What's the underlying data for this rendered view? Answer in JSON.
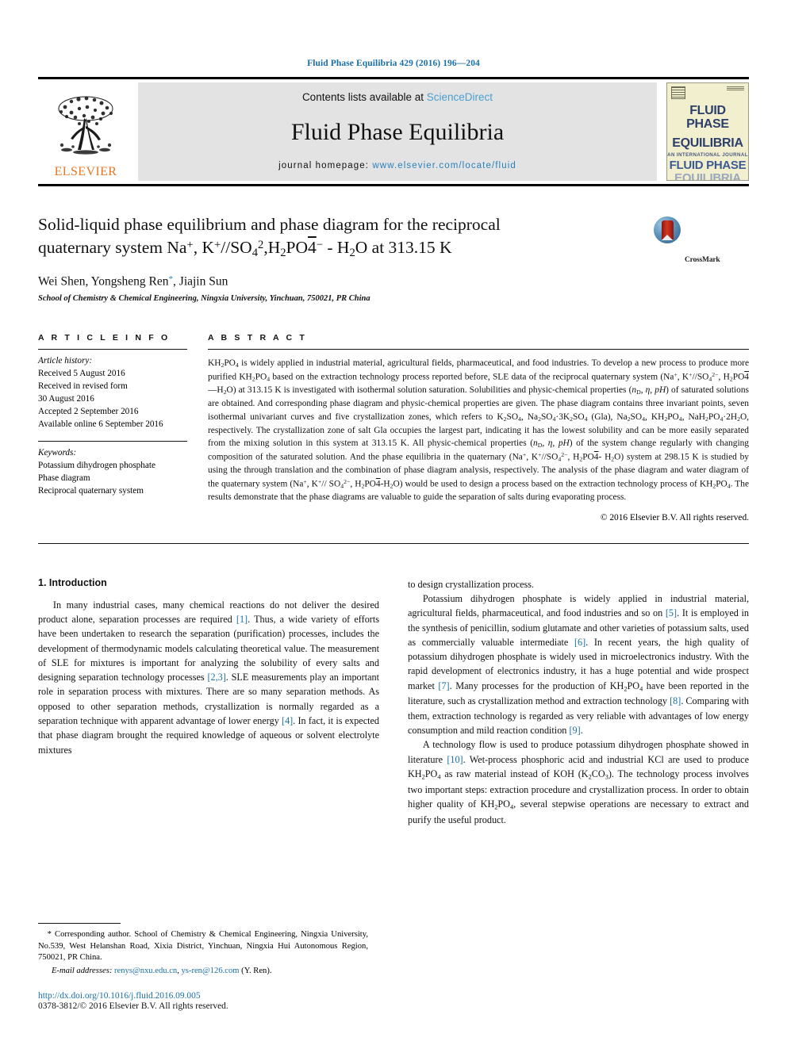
{
  "running_head": "Fluid Phase Equilibria 429 (2016) 196—204",
  "masthead": {
    "contents_prefix": "Contents lists available at ",
    "contents_link": "ScienceDirect",
    "journal_title": "Fluid Phase Equilibria",
    "homepage_prefix": "journal homepage: ",
    "homepage_url": "www.elsevier.com/locate/fluid",
    "publisher": "ELSEVIER",
    "cover": {
      "line1": "FLUID PHASE",
      "line2": "EQUILIBRIA",
      "subtitle": "AN INTERNATIONAL JOURNAL",
      "line3": "FLUID PHASE",
      "line4": "EQUILIBRIA"
    }
  },
  "article": {
    "title_line1": "Solid-liquid phase equilibrium and phase diagram for the reciprocal",
    "title_line2_pre": "quaternary system Na",
    "title_full_plain": "Solid-liquid phase equilibrium and phase diagram for the reciprocal quaternary system Na+, K+//SO42-,H2PO4- - H2O at 313.15 K",
    "crossmark_label": "CrossMark",
    "authors_plain": "Wei Shen, Yongsheng Ren*, Jiajin Sun",
    "author1": "Wei Shen, Yongsheng Ren",
    "author2": ", Jiajin Sun",
    "affiliation": "School of Chemistry & Chemical Engineering, Ningxia University, Yinchuan, 750021, PR China"
  },
  "info": {
    "heading": "A R T I C L E   I N F O",
    "history_label": "Article history:",
    "history": [
      "Received 5 August 2016",
      "Received in revised form",
      "30 August 2016",
      "Accepted 2 September 2016",
      "Available online 6 September 2016"
    ],
    "keywords_label": "Keywords:",
    "keywords": [
      "Potassium dihydrogen phosphate",
      "Phase diagram",
      "Reciprocal quaternary system"
    ]
  },
  "abstract": {
    "heading": "A B S T R A C T",
    "copyright": "© 2016 Elsevier B.V. All rights reserved.",
    "text_plain": "KH2PO4 is widely applied in industrial material, agricultural fields, pharmaceutical, and food industries. To develop a new process to produce more purified KH2PO4 based on the extraction technology process reported before, SLE data of the reciprocal quaternary system (Na+, K+//SO42-, H2PO4-—H2O) at 313.15 K is investigated with isothermal solution saturation. Solubilities and physic-chemical properties (nD, η, pH) of saturated solutions are obtained. And corresponding phase diagram and physic-chemical properties are given. The phase diagram contains three invariant points, seven isothermal univariant curves and five crystallization zones, which refers to K2SO4, Na2SO4·3K2SO4 (Gla), Na2SO4, KH2PO4, NaH2PO4·2H2O, respectively. The crystallization zone of salt Gla occupies the largest part, indicating it has the lowest solubility and can be more easily separated from the mixing solution in this system at 313.15 K. All physic-chemical properties (nD, η, pH) of the system change regularly with changing composition of the saturated solution. And the phase equilibria in the quaternary (Na+, K+//SO42-, H2PO4- H2O) system at 298.15 K is studied by using the through translation and the combination of phase diagram analysis, respectively. The analysis of the phase diagram and water diagram of the quaternary system (Na+, K+//SO42-, H2PO4--H2O) would be used to design a process based on the extraction technology process of KH2PO4. The results demonstrate that the phase diagrams are valuable to guide the separation of salts during evaporating process."
  },
  "introduction": {
    "heading": "1.  Introduction",
    "left_p1_plain": "In many industrial cases, many chemical reactions do not deliver the desired product alone, separation processes are required [1]. Thus, a wide variety of efforts have been undertaken to research the separation (purification) processes, includes the development of thermodynamic models calculating theoretical value. The measurement of SLE for mixtures is important for analyzing the solubility of every salts and designing separation technology processes [2,3]. SLE measurements play an important role in separation process with mixtures. There are so many separation methods. As opposed to other separation methods, crystallization is normally regarded as a separation technique with apparent advantage of lower energy [4]. In fact, it is expected that phase diagram brought the required knowledge of aqueous or solvent electrolyte mixtures to design crystallization process.",
    "right_continuation": "to design crystallization process.",
    "right_p2_plain": "Potassium dihydrogen phosphate is widely applied in industrial material, agricultural fields, pharmaceutical, and food industries and so on [5]. It is employed in the synthesis of penicillin, sodium glutamate and other varieties of potassium salts, used as commercially valuable intermediate [6]. In recent years, the high quality of potassium dihydrogen phosphate is widely used in microelectronics industry. With the rapid development of electronics industry, it has a huge potential and wide prospect market [7]. Many processes for the production of KH2PO4 have been reported in the literature, such as crystallization method and extraction technology [8]. Comparing with them, extraction technology is regarded as very reliable with advantages of low energy consumption and mild reaction condition [9].",
    "right_p3_plain": "A technology flow is used to produce potassium dihydrogen phosphate showed in literature [10]. Wet-process phosphoric acid and industrial KCl are used to produce KH2PO4 as raw material instead of KOH (K2CO3). The technology process involves two important steps: extraction procedure and crystallization process. In order to obtain higher quality of KH2PO4, several stepwise operations are necessary to extract and purify the useful product."
  },
  "footnote": {
    "corresponding_plain": "* Corresponding author. School of Chemistry & Chemical Engineering, Ningxia University, No.539, West Helanshan Road, Xixia District, Yinchuan, Ningxia Hui Autonomous Region, 750021, PR China.",
    "email_label": "E-mail addresses:",
    "email1": "renys@nxu.edu.cn",
    "email2": "ys-ren@126.com",
    "email_suffix": "(Y. Ren).",
    "doi": "http://dx.doi.org/10.1016/j.fluid.2016.09.005",
    "issn_line": "0378-3812/© 2016 Elsevier B.V. All rights reserved."
  },
  "colors": {
    "link_blue": "#1a6fa8",
    "sciencedirect_blue": "#4a9fd4",
    "elsevier_orange": "#E87722",
    "band_gray": "#e3e3e3"
  }
}
